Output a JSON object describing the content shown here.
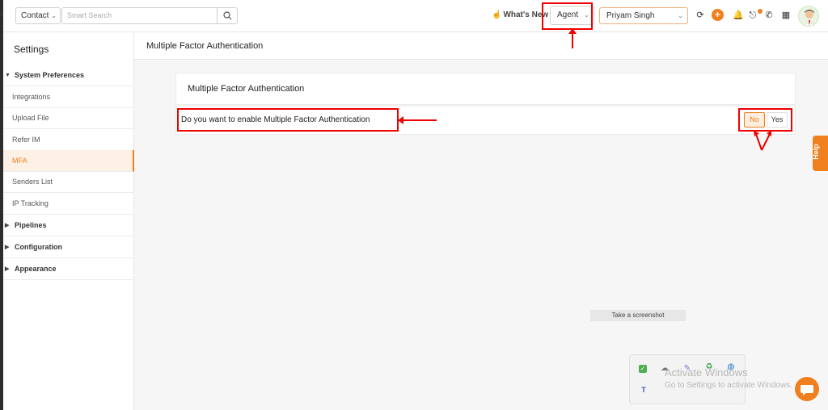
{
  "topbar": {
    "entity_select": "Contact",
    "search_placeholder": "Smart Search",
    "whats_new": "What's New",
    "role_select": "Agent",
    "user_select": "Priyam Singh"
  },
  "sidebar": {
    "title": "Settings",
    "items": [
      {
        "label": "System Preferences"
      },
      {
        "label": "Integrations"
      },
      {
        "label": "Upload File"
      },
      {
        "label": "Refer IM"
      },
      {
        "label": "MFA"
      },
      {
        "label": "Senders List"
      },
      {
        "label": "IP Tracking"
      },
      {
        "label": "Pipelines"
      },
      {
        "label": "Configuration"
      },
      {
        "label": "Appearance"
      }
    ]
  },
  "content": {
    "page_title": "Multiple Factor Authentication",
    "card_title": "Multiple Factor Authentication",
    "question": "Do you want to enable Multiple Factor Authentication",
    "no_label": "No",
    "yes_label": "Yes",
    "selected": "No"
  },
  "help_label": "Help",
  "screenshot_tooltip": "Take a screenshot",
  "watermark": {
    "title": "Activate Windows",
    "subtitle": "Go to Settings to activate Windows."
  },
  "icons": {
    "search": "search-icon",
    "refresh": "refresh-icon",
    "add": "plus-icon",
    "bell": "bell-icon",
    "logout": "logout-icon",
    "phone": "phone-icon",
    "calculator": "calculator-icon",
    "avatar": "avatar",
    "chat": "chat-icon"
  },
  "colors": {
    "accent": "#f07f1e",
    "annotation": "#e00000"
  }
}
